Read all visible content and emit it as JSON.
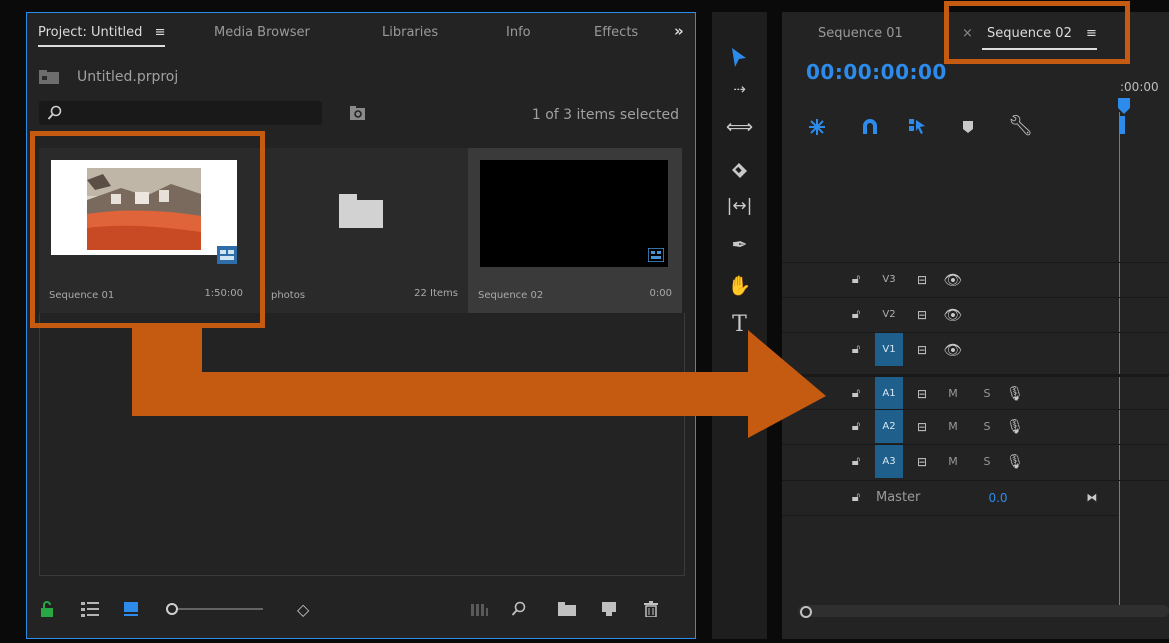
{
  "project": {
    "tabs": [
      {
        "label": "Project: Untitled",
        "active": true
      },
      {
        "label": "Media Browser"
      },
      {
        "label": "Libraries"
      },
      {
        "label": "Info"
      },
      {
        "label": "Effects"
      }
    ],
    "overflow_glyph": "»",
    "menu_glyph": "≡",
    "project_file": "Untitled.prproj",
    "search_placeholder": "",
    "items_selected": "1 of 3 items selected",
    "items": [
      {
        "label": "Sequence 01",
        "meta": "1:50:00",
        "kind": "sequence-image"
      },
      {
        "label": "photos",
        "meta": "22 Items",
        "kind": "bin"
      },
      {
        "label": "Sequence 02",
        "meta": "0:00",
        "kind": "sequence-black"
      }
    ]
  },
  "timeline": {
    "tabs": [
      {
        "label": "Sequence 01"
      },
      {
        "label": "Sequence 02",
        "active": true
      }
    ],
    "close_glyph": "×",
    "menu_glyph": "≡",
    "timecode": "00:00:00:00",
    "ruler_label": ":00:00",
    "video_tracks": [
      "V3",
      "V2",
      "V1"
    ],
    "audio_tracks": [
      "A1",
      "A2",
      "A3"
    ],
    "mute_label": "M",
    "solo_label": "S",
    "master": {
      "label": "Master",
      "value": "0.0"
    }
  },
  "colors": {
    "accent": "#2d8ceb",
    "highlight": "#c55a11",
    "lock_green": "#27a845",
    "track_blue": "#1f5f8b"
  }
}
